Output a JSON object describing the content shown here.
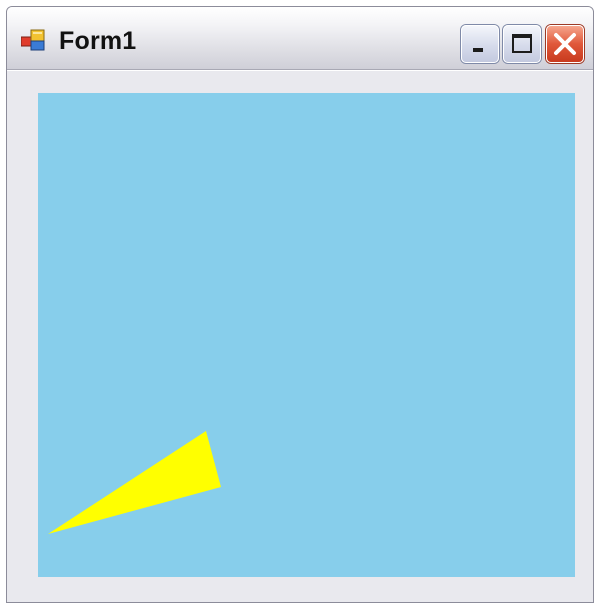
{
  "window": {
    "title": "Form1",
    "controls": {
      "minimize_icon": "minimize-icon",
      "maximize_icon": "maximize-icon",
      "close_icon": "close-icon"
    }
  },
  "canvas": {
    "background_color": "#87ceeb",
    "shape": {
      "type": "triangle",
      "fill_color": "#ffff00"
    }
  }
}
